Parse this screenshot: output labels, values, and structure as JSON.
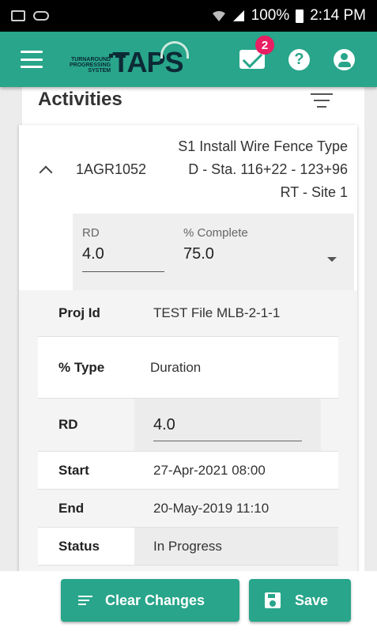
{
  "status_bar": {
    "signal_text": "100%",
    "time": "2:14 PM"
  },
  "app_bar": {
    "logo_small": "TURNAROUND PROGRESSING SYSTEM",
    "logo_big": "TAPS",
    "mail_badge": "2",
    "help_icon": "?",
    "color": "#28a58a"
  },
  "page": {
    "title": "Activities"
  },
  "activity": {
    "id": "1AGR1052",
    "description": "S1 Install Wire Fence Type D - Sta. 116+22 - 123+96 RT - Site 1",
    "rd_label": "RD",
    "rd_value": "4.0",
    "pct_label": "% Complete",
    "pct_value": "75.0"
  },
  "details": {
    "rows": [
      {
        "label": "Proj Id",
        "value": "TEST File MLB-2-1-1"
      },
      {
        "label": "% Type",
        "value": "Duration"
      },
      {
        "label": "RD",
        "value": "4.0"
      },
      {
        "label": "Start",
        "value": "27-Apr-2021 08:00"
      },
      {
        "label": "End",
        "value": "20-May-2019 11:10"
      },
      {
        "label": "Status",
        "value": "In Progress"
      }
    ]
  },
  "buttons": {
    "clear": "Clear Changes",
    "save": "Save"
  },
  "icons": [
    "image-icon",
    "voicemail-icon",
    "wifi-icon",
    "signal-icon",
    "battery-icon",
    "menu-icon",
    "mail-icon",
    "help-icon",
    "account-icon",
    "filter-icon",
    "chevron-up-icon",
    "dropdown-caret-icon",
    "list-icon",
    "save-icon"
  ]
}
